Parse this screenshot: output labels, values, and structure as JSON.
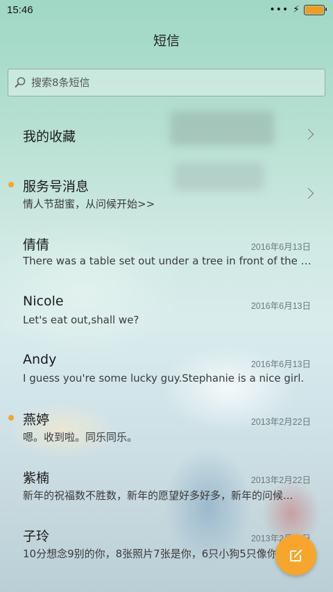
{
  "status_bar": {
    "time": "15:46",
    "icons": [
      "more-dots-icon",
      "charging-bolt-icon",
      "battery-icon"
    ],
    "battery_level": 1.0,
    "battery_color": "#f39a1f"
  },
  "header": {
    "title": "短信"
  },
  "search": {
    "placeholder": "搜索8条短信"
  },
  "favorites": {
    "label": "我的收藏"
  },
  "service": {
    "title": "服务号消息",
    "subtitle": "情人节甜蜜，从问候开始>>",
    "unread": true
  },
  "conversations": [
    {
      "name": "倩倩",
      "date": "2016年6月13日",
      "preview": "There was a table set out under a tree in front of the ho...",
      "unread": false
    },
    {
      "name": "Nicole",
      "date": "2016年6月13日",
      "preview": "Let's eat out,shall we?",
      "unread": false
    },
    {
      "name": "Andy",
      "date": "2016年6月13日",
      "preview": "I guess you're some lucky guy.Stephanie is a nice girl.",
      "unread": false
    },
    {
      "name": "燕婷",
      "date": "2013年2月22日",
      "preview": "嗯。收到啦。同乐同乐。",
      "unread": true
    },
    {
      "name": "紫楠",
      "date": "2013年2月22日",
      "preview": "新年的祝福数不胜数，新年的愿望好多好多，新年的问候...",
      "unread": false
    },
    {
      "name": "子玲",
      "date": "2013年2月22日",
      "preview": "10分想念9别的你，8张照片7张是你，6只小狗5只像你",
      "unread": false
    }
  ],
  "fab": {
    "icon": "compose-icon",
    "color": "#f7a62b"
  },
  "colors": {
    "accent": "#f5a623"
  }
}
